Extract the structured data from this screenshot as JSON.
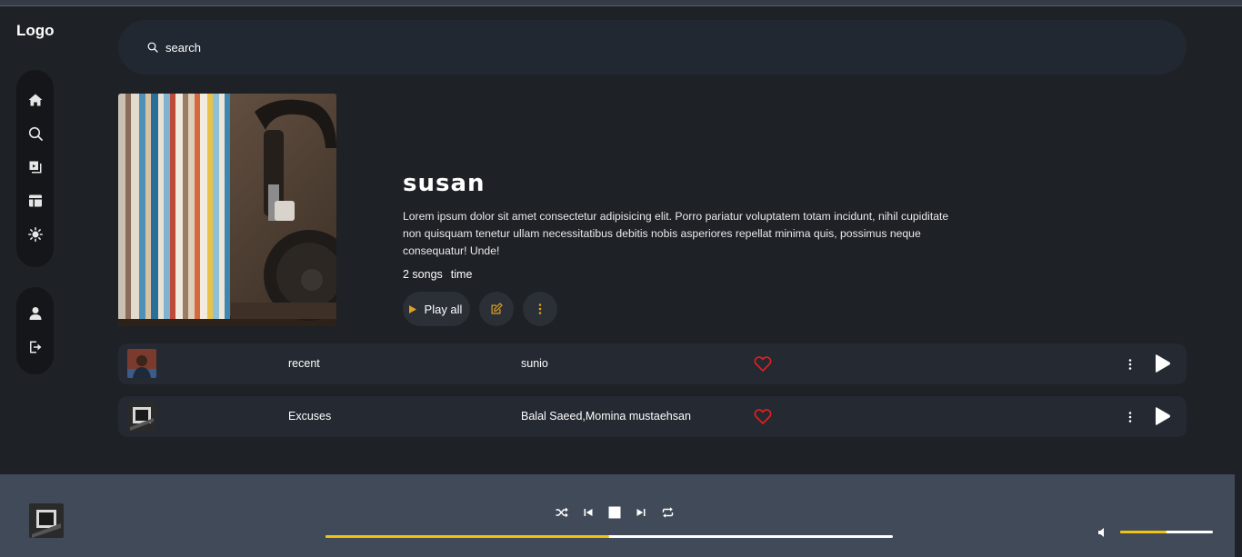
{
  "logo": "Logo",
  "sidebar": {
    "main_items": [
      {
        "icon": "home-icon"
      },
      {
        "icon": "search-icon"
      },
      {
        "icon": "playlist-icon"
      },
      {
        "icon": "layout-icon"
      },
      {
        "icon": "theme-toggle-icon"
      }
    ],
    "user_items": [
      {
        "icon": "user-icon"
      },
      {
        "icon": "logout-icon"
      }
    ]
  },
  "search": {
    "placeholder": "search"
  },
  "playlist": {
    "title": "susan",
    "description": "Lorem ipsum dolor sit amet consectetur adipisicing elit. Porro pariatur voluptatem totam incidunt, nihil cupiditate non quisquam tenetur ullam necessitatibus debitis nobis asperiores repellat minima quis, possimus neque consequatur! Unde!",
    "songs_count": "2 songs",
    "time": "time",
    "play_all_label": "Play all"
  },
  "tracks": [
    {
      "name": "recent",
      "artist": "sunio"
    },
    {
      "name": "Excuses",
      "artist": "Balal Saeed,Momina mustaehsan"
    }
  ],
  "player": {
    "progress": 0.5,
    "volume": 0.5
  },
  "colors": {
    "accent": "#f1c40f",
    "heart": "#e02020",
    "background": "#1e2126",
    "player_bar": "#414a58"
  }
}
